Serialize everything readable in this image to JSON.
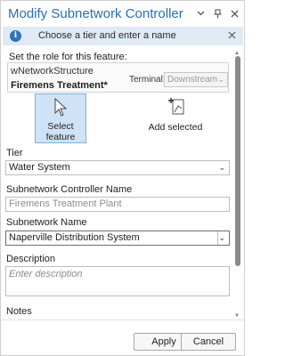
{
  "window": {
    "title": "Modify Subnetwork Controller",
    "icons": [
      "chevron-down-icon",
      "pin-icon",
      "close-icon"
    ]
  },
  "banner": {
    "message": "Choose a tier and enter a name",
    "info_glyph": "i"
  },
  "role": {
    "heading": "Set the role for this feature:",
    "network_name": "wNetworkStructure",
    "feature_name": "Firemens Treatment*",
    "terminal_label": "Terminal:",
    "terminal_value": "Downstream"
  },
  "tools": {
    "select_feature_line1": "Select",
    "select_feature_line2": "feature",
    "add_selected": "Add selected"
  },
  "tier": {
    "label": "Tier",
    "value": "Water System"
  },
  "controller_name": {
    "label": "Subnetwork Controller Name",
    "placeholder": "Firemens Treatment Plant"
  },
  "subnetwork_name": {
    "label": "Subnetwork Name",
    "value": "Naperville Distribution System"
  },
  "description": {
    "label": "Description",
    "placeholder": "Enter description"
  },
  "notes": {
    "label": "Notes"
  },
  "footer": {
    "apply_label": "Apply",
    "cancel_label": "Cancel"
  },
  "colors": {
    "title": "#2a6fb0",
    "banner_bg": "#dfeaf5",
    "info_icon": "#2f73b8",
    "active_tool_bg": "#cfe3f6"
  }
}
